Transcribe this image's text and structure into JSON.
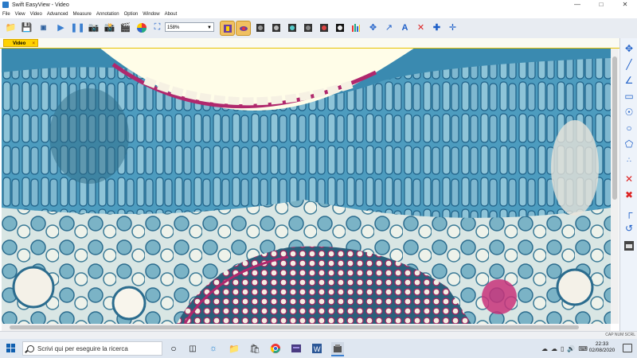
{
  "window": {
    "title": "Swift EasyView - Video"
  },
  "menu": [
    "File",
    "View",
    "Video",
    "Advanced",
    "Measure",
    "Annotation",
    "Option",
    "Window",
    "About"
  ],
  "toolbar": {
    "zoom": "158%"
  },
  "tabs": [
    {
      "label": "Video",
      "close": "×"
    }
  ],
  "status": {
    "indicators": "CAP NUM SCRL"
  },
  "taskbar": {
    "search_placeholder": "Scrivi qui per eseguire la ricerca",
    "time": "22:33",
    "date": "02/08/2020"
  },
  "colors": {
    "accent": "#ffd200",
    "toolbar_bg": "#e8ecf2",
    "taskbar_bg": "#dfe7f1",
    "stain_blue": "#3f8fb5",
    "stain_magenta": "#b0286d"
  },
  "icons": {
    "toolbar": [
      "open-folder-icon",
      "save-icon",
      "export-icon",
      "play-icon",
      "pause-icon",
      "camera-icon",
      "snapshot-icon",
      "video-icon",
      "color-icon",
      "fit-screen-icon",
      "channel-icon",
      "flip-icon",
      "filter-icon",
      "filter-icon",
      "filter-icon",
      "filter-icon",
      "filter-icon",
      "filter-icon",
      "levels-icon",
      "move-icon",
      "arrow-icon",
      "text-icon",
      "delete-icon",
      "crosshair-icon",
      "crosshair-dashed-icon"
    ],
    "side": [
      "move-icon",
      "line-icon",
      "angle-icon",
      "rectangle-icon",
      "circle-center-icon",
      "circle-icon",
      "polygon-icon",
      "three-circle-icon",
      "delete-icon",
      "delete-all-icon",
      "ruler-icon",
      "calibrate-icon",
      "csv-icon"
    ]
  }
}
